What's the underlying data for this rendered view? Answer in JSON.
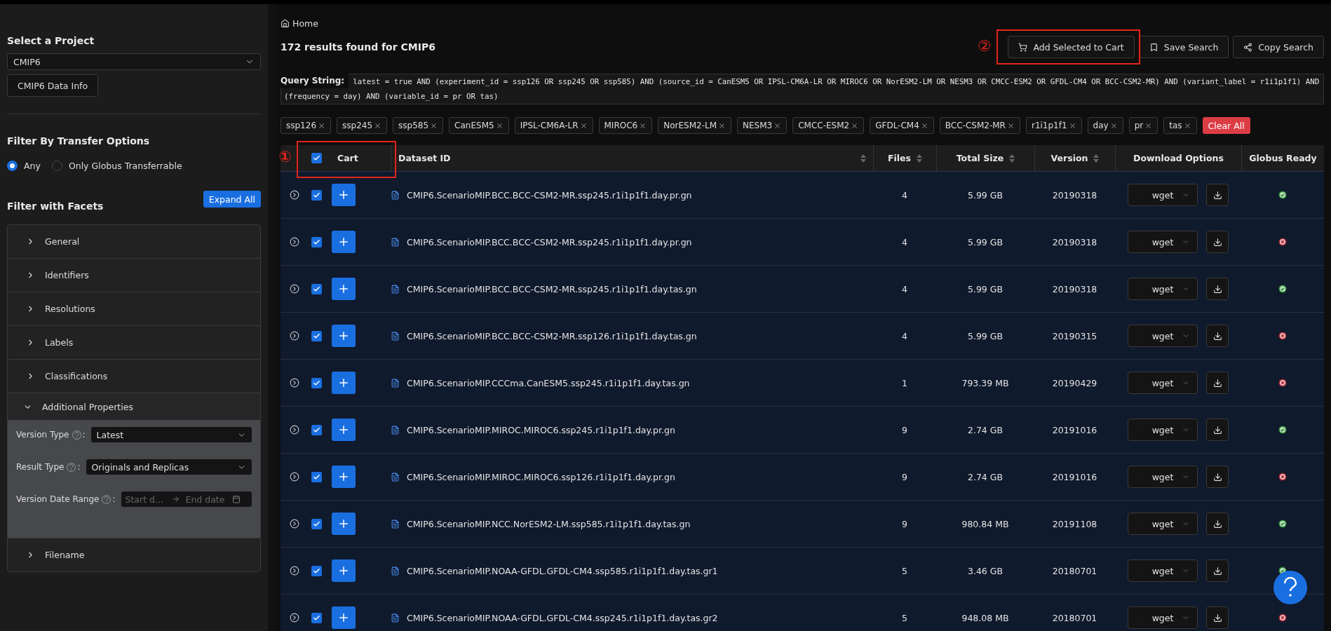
{
  "sidebar": {
    "project_heading": "Select a Project",
    "project_select": "CMIP6",
    "data_info_button": "CMIP6 Data Info",
    "transfer_heading": "Filter By Transfer Options",
    "transfer_options": [
      {
        "label": "Any",
        "selected": true
      },
      {
        "label": "Only Globus Transferrable",
        "selected": false
      }
    ],
    "facets_heading": "Filter with Facets",
    "expand_all_button": "Expand All",
    "facet_groups": [
      {
        "label": "General",
        "expanded": false
      },
      {
        "label": "Identifiers",
        "expanded": false
      },
      {
        "label": "Resolutions",
        "expanded": false
      },
      {
        "label": "Labels",
        "expanded": false
      },
      {
        "label": "Classifications",
        "expanded": false
      },
      {
        "label": "Additional Properties",
        "expanded": true,
        "fields": [
          {
            "kind": "select",
            "label": "Version Type",
            "separator": ":",
            "value": "Latest"
          },
          {
            "kind": "select",
            "label": "Result Type",
            "separator": ":",
            "value": "Originals and Replicas"
          },
          {
            "kind": "date_range",
            "label": "Version Date Range",
            "separator": ":",
            "start_placeholder": "Start d...",
            "end_placeholder": "End date"
          }
        ]
      },
      {
        "label": "Filename",
        "expanded": false
      }
    ]
  },
  "breadcrumb": "Home",
  "results_title": "172 results found for CMIP6",
  "actions": [
    {
      "kind": "cart",
      "label": "Add Selected to Cart"
    },
    {
      "kind": "save",
      "label": "Save Search"
    },
    {
      "kind": "copy",
      "label": "Copy Search"
    }
  ],
  "query_label": "Query String:",
  "query": "latest = true AND (experiment_id = ssp126 OR ssp245 OR ssp585) AND (source_id = CanESM5 OR IPSL-CM6A-LR OR MIROC6 OR NorESM2-LM OR NESM3 OR CMCC-ESM2 OR GFDL-CM4 OR BCC-CSM2-MR) AND (variant_label = r1i1p1f1) AND (frequency = day) AND (variable_id = pr OR tas)",
  "filter_tags": [
    "ssp126",
    "ssp245",
    "ssp585",
    "CanESM5",
    "IPSL-CM6A-LR",
    "MIROC6",
    "NorESM2-LM",
    "NESM3",
    "CMCC-ESM2",
    "GFDL-CM4",
    "BCC-CSM2-MR",
    "r1i1p1f1",
    "day",
    "pr",
    "tas"
  ],
  "clear_all_button": "Clear All",
  "table": {
    "select_all_checked": true,
    "columns": [
      {
        "label": "Cart",
        "sortable": false
      },
      {
        "label": "Dataset ID",
        "sortable": true
      },
      {
        "label": "Files",
        "sortable": true
      },
      {
        "label": "Total Size",
        "sortable": true
      },
      {
        "label": "Version",
        "sortable": true
      },
      {
        "label": "Download Options",
        "sortable": false
      },
      {
        "label": "Globus Ready",
        "sortable": false
      }
    ],
    "rows": [
      {
        "checked": true,
        "dataset_id": "CMIP6.ScenarioMIP.BCC.BCC-CSM2-MR.ssp245.r1i1p1f1.day.pr.gn",
        "files": "4",
        "total_size": "5.99 GB",
        "version": "20190318",
        "download_option": "wget",
        "globus_ready": true
      },
      {
        "checked": true,
        "dataset_id": "CMIP6.ScenarioMIP.BCC.BCC-CSM2-MR.ssp245.r1i1p1f1.day.pr.gn",
        "files": "4",
        "total_size": "5.99 GB",
        "version": "20190318",
        "download_option": "wget",
        "globus_ready": false
      },
      {
        "checked": true,
        "dataset_id": "CMIP6.ScenarioMIP.BCC.BCC-CSM2-MR.ssp245.r1i1p1f1.day.tas.gn",
        "files": "4",
        "total_size": "5.99 GB",
        "version": "20190318",
        "download_option": "wget",
        "globus_ready": true
      },
      {
        "checked": true,
        "dataset_id": "CMIP6.ScenarioMIP.BCC.BCC-CSM2-MR.ssp126.r1i1p1f1.day.tas.gn",
        "files": "4",
        "total_size": "5.99 GB",
        "version": "20190315",
        "download_option": "wget",
        "globus_ready": false
      },
      {
        "checked": true,
        "dataset_id": "CMIP6.ScenarioMIP.CCCma.CanESM5.ssp245.r1i1p1f1.day.tas.gn",
        "files": "1",
        "total_size": "793.39 MB",
        "version": "20190429",
        "download_option": "wget",
        "globus_ready": false
      },
      {
        "checked": true,
        "dataset_id": "CMIP6.ScenarioMIP.MIROC.MIROC6.ssp245.r1i1p1f1.day.pr.gn",
        "files": "9",
        "total_size": "2.74 GB",
        "version": "20191016",
        "download_option": "wget",
        "globus_ready": true
      },
      {
        "checked": true,
        "dataset_id": "CMIP6.ScenarioMIP.MIROC.MIROC6.ssp126.r1i1p1f1.day.pr.gn",
        "files": "9",
        "total_size": "2.74 GB",
        "version": "20191016",
        "download_option": "wget",
        "globus_ready": false
      },
      {
        "checked": true,
        "dataset_id": "CMIP6.ScenarioMIP.NCC.NorESM2-LM.ssp585.r1i1p1f1.day.tas.gn",
        "files": "9",
        "total_size": "980.84 MB",
        "version": "20191108",
        "download_option": "wget",
        "globus_ready": true
      },
      {
        "checked": true,
        "dataset_id": "CMIP6.ScenarioMIP.NOAA-GFDL.GFDL-CM4.ssp585.r1i1p1f1.day.tas.gr1",
        "files": "5",
        "total_size": "3.46 GB",
        "version": "20180701",
        "download_option": "wget",
        "globus_ready": true
      },
      {
        "checked": true,
        "dataset_id": "CMIP6.ScenarioMIP.NOAA-GFDL.GFDL-CM4.ssp245.r1i1p1f1.day.tas.gr2",
        "files": "5",
        "total_size": "948.08 MB",
        "version": "20180701",
        "download_option": "wget",
        "globus_ready": false
      }
    ]
  },
  "annotations": [
    {
      "label": "①"
    },
    {
      "label": "②"
    }
  ]
}
